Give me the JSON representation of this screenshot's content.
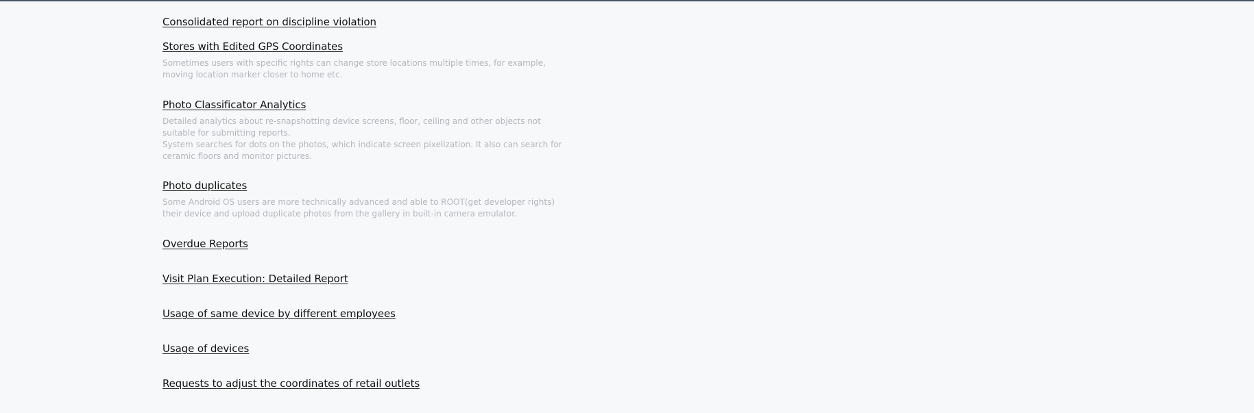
{
  "reports": [
    {
      "title": "Consolidated report on discipline violation",
      "description": []
    },
    {
      "title": "Stores with Edited GPS Coordinates",
      "description": [
        "Sometimes users with specific rights can change store locations multiple times, for example, moving location marker closer to home etc."
      ]
    },
    {
      "title": "Photo Classificator Analytics",
      "description": [
        "Detailed analytics about re-snapshotting device screens, floor, ceiling and other objects not suitable for submitting reports.",
        "System searches for dots on the photos, which indicate screen pixelization. It also can search for ceramic floors and monitor pictures."
      ]
    },
    {
      "title": "Photo duplicates",
      "description": [
        "Some Android OS users are more technically advanced and able to ROOT(get developer rights) their device and upload duplicate photos from the gallery in built-in camera emulator."
      ]
    },
    {
      "title": "Overdue Reports",
      "description": []
    },
    {
      "title": "Visit Plan Execution: Detailed Report",
      "description": []
    },
    {
      "title": "Usage of same device by different employees",
      "description": []
    },
    {
      "title": "Usage of devices",
      "description": []
    },
    {
      "title": "Requests to adjust the coordinates of retail outlets",
      "description": []
    }
  ]
}
